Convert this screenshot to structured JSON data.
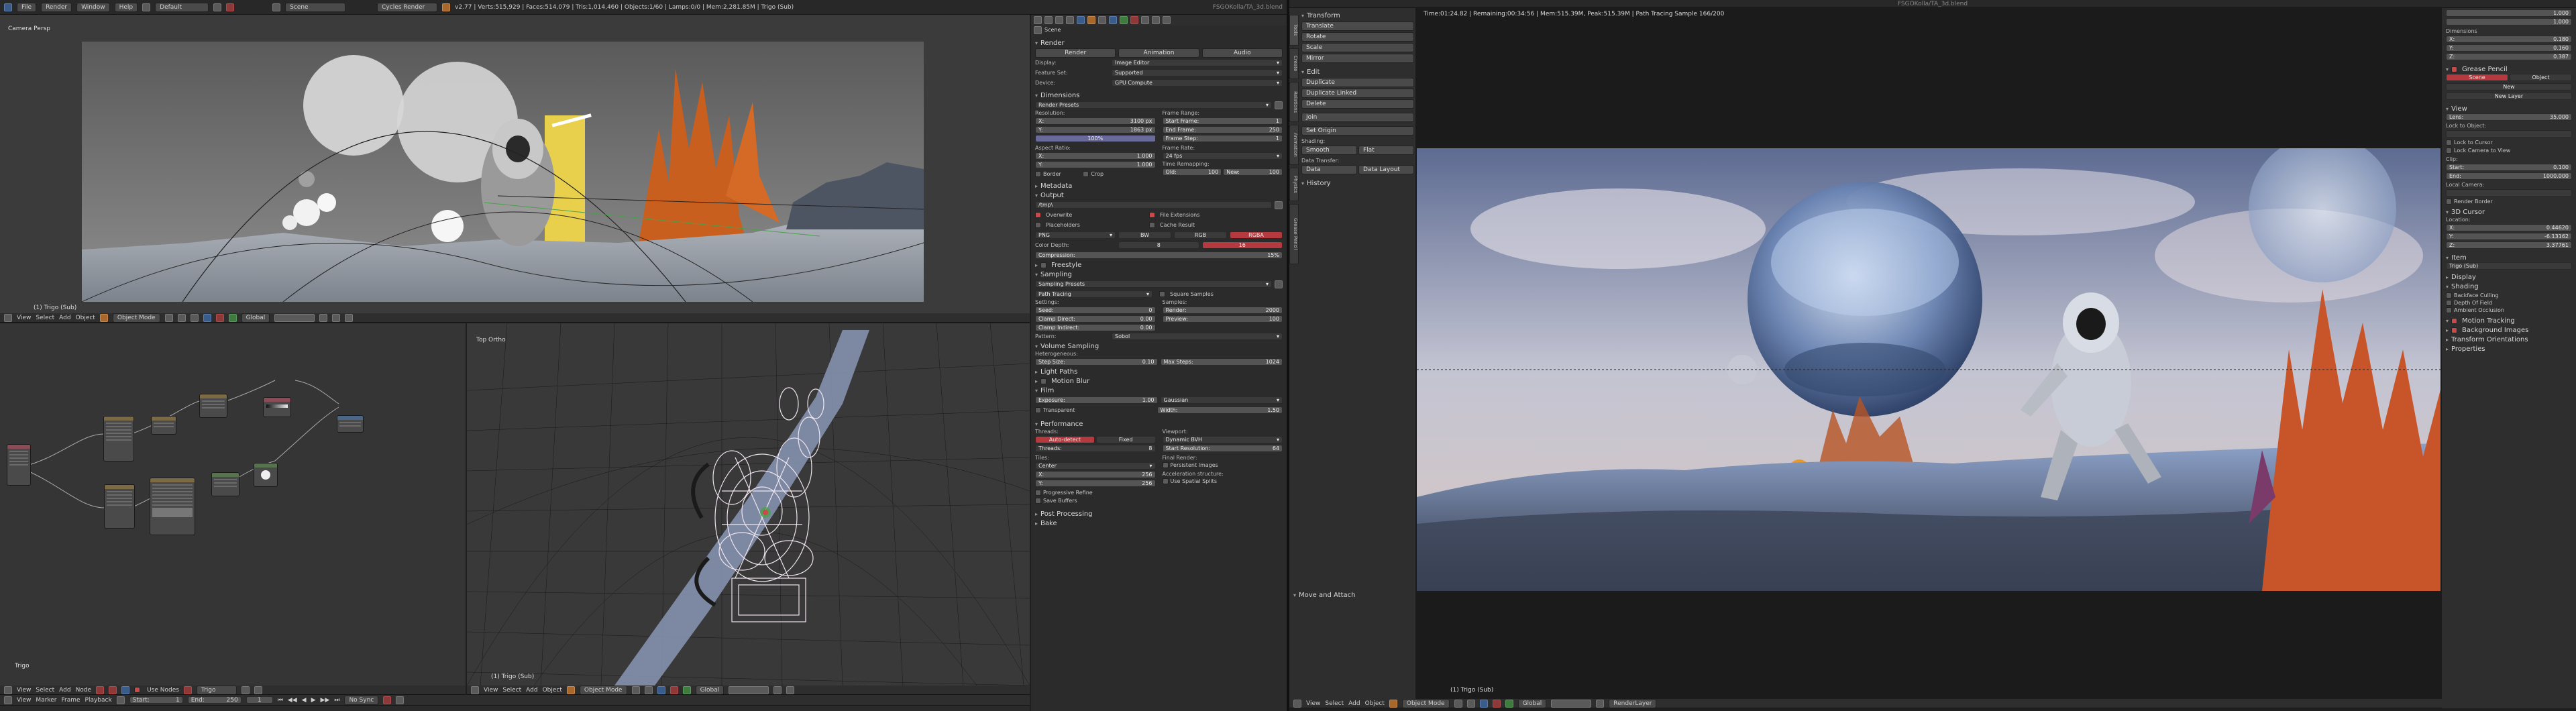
{
  "topbar": {
    "menus": [
      "File",
      "Render",
      "Window",
      "Help"
    ],
    "layout": "Default",
    "scene": "Scene",
    "engine": "Cycles Render",
    "stats": "v2.77 | Verts:515,929 | Faces:514,079 | Tris:1,014,460 | Objects:1/60 | Lamps:0/0 | Mem:2,281.85M | Trigo (Sub)",
    "title_left": "FSGOKolla/TA_3d.blend",
    "title_right": "FSGOKolla/TA_3d.blend"
  },
  "viewport_camera": {
    "label": "Camera Persp",
    "object_label": "(1) Trigo (Sub)",
    "header_items": [
      "View",
      "Select",
      "Add",
      "Object"
    ],
    "mode": "Object Mode",
    "pivot": "Global"
  },
  "node_editor": {
    "label": "Trigo",
    "header_items": [
      "View",
      "Select",
      "Add",
      "Node"
    ],
    "use_nodes": "Use Nodes"
  },
  "viewport_wire": {
    "label": "Top Ortho",
    "object_label": "(1) Trigo (Sub)",
    "header_items": [
      "View",
      "Select",
      "Add",
      "Object"
    ],
    "mode": "Object Mode",
    "pivot": "Global"
  },
  "timeline": {
    "items": [
      "View",
      "Marker",
      "Frame",
      "Playback"
    ],
    "start": "Start:",
    "start_val": "1",
    "end": "End:",
    "end_val": "250",
    "current": "1",
    "sync": "No Sync"
  },
  "properties": {
    "scene_label": "Scene",
    "render_header": "Render",
    "render_buttons": [
      "Render",
      "Animation",
      "Audio"
    ],
    "display_label": "Display:",
    "display_val": "Image Editor",
    "feature_label": "Feature Set:",
    "feature_val": "Supported",
    "device_label": "Device:",
    "device_val": "GPU Compute",
    "dimensions": "Dimensions",
    "render_presets": "Render Presets",
    "resolution": "Resolution:",
    "res_x": "3100 px",
    "res_y": "1863 px",
    "res_pct": "100%",
    "frame_range": "Frame Range:",
    "start_frame": "Start Frame:",
    "start_frame_val": "1",
    "end_frame": "End Frame:",
    "end_frame_val": "250",
    "frame_step": "Frame Step:",
    "frame_step_val": "1",
    "aspect": "Aspect Ratio:",
    "aspect_x": "1.000",
    "aspect_y": "1.000",
    "frame_rate": "Frame Rate:",
    "fps": "24 fps",
    "time_remap": "Time Remapping:",
    "tr_old": "100",
    "tr_new": "100",
    "border": "Border",
    "crop": "Crop",
    "metadata": "Metadata",
    "output": "Output",
    "output_path": "/tmp\\",
    "overwrite": "Overwrite",
    "file_ext": "File Extensions",
    "placeholders": "Placeholders",
    "cache_result": "Cache Result",
    "format": "PNG",
    "bw": "BW",
    "rgb": "RGB",
    "rgba": "RGBA",
    "color_depth": "Color Depth:",
    "depth8": "8",
    "depth16": "16",
    "compression": "Compression:",
    "compression_val": "15%",
    "freestyle": "Freestyle",
    "sampling": "Sampling",
    "sampling_presets": "Sampling Presets",
    "path_tracing": "Path Tracing",
    "square_samples": "Square Samples",
    "settings": "Settings:",
    "seed": "Seed:",
    "seed_val": "0",
    "clamp_direct": "Clamp Direct:",
    "clamp_direct_val": "0.00",
    "clamp_indirect": "Clamp Indirect:",
    "clamp_indirect_val": "0.00",
    "samples": "Samples:",
    "render_samples": "Render:",
    "render_samples_val": "2000",
    "preview_samples": "Preview:",
    "preview_samples_val": "100",
    "pattern": "Pattern:",
    "pattern_val": "Sobol",
    "volume_sampling": "Volume Sampling",
    "heterogeneous": "Heterogeneous:",
    "step_size": "Step Size:",
    "step_size_val": "0.10",
    "max_steps": "Max Steps:",
    "max_steps_val": "1024",
    "light_paths": "Light Paths",
    "motion_blur": "Motion Blur",
    "film": "Film",
    "exposure": "Exposure:",
    "exposure_val": "1.00",
    "filter": "Gaussian",
    "width": "Width:",
    "width_val": "1.50",
    "transparent": "Transparent",
    "performance": "Performance",
    "threads": "Threads:",
    "auto_detect": "Auto-detect",
    "fixed": "Fixed",
    "threads_val": "8",
    "tiles": "Tiles:",
    "center": "Center",
    "tile_x": "256",
    "tile_y": "256",
    "progressive": "Progressive Refine",
    "save_buffers": "Save Buffers",
    "viewport": "Viewport:",
    "dynamic_bvh": "Dynamic BVH",
    "start_res": "Start Resolution:",
    "start_res_val": "64",
    "final_render": "Final Render:",
    "persistent": "Persistent Images",
    "accel": "Acceleration structure:",
    "spatial": "Use Spatial Splits",
    "post_processing": "Post Processing",
    "bake": "Bake"
  },
  "toolshelf": {
    "transform": "Transform",
    "translate": "Translate",
    "rotate": "Rotate",
    "scale": "Scale",
    "mirror": "Mirror",
    "edit": "Edit",
    "duplicate": "Duplicate",
    "dup_linked": "Duplicate Linked",
    "delete": "Delete",
    "join": "Join",
    "set_origin": "Set Origin",
    "shading": "Shading:",
    "smooth": "Smooth",
    "flat": "Flat",
    "data_transfer": "Data Transfer:",
    "data": "Data",
    "data_layout": "Data Layout",
    "history": "History",
    "move_attach": "Move and Attach",
    "tabs": [
      "Tools",
      "Create",
      "Relations",
      "Animation",
      "Physics",
      "Grease Pencil"
    ]
  },
  "render_view": {
    "status": "Time:01:24.82 | Remaining:00:34:56 | Mem:515.39M, Peak:515.39M | Path Tracing Sample 166/200",
    "object_label": "(1) Trigo (Sub)",
    "header_items": [
      "View",
      "Select",
      "Add",
      "Object"
    ],
    "mode": "Object Mode",
    "pivot": "Global",
    "layer": "RenderLayer"
  },
  "npanel": {
    "top_vals": [
      "1.000",
      "1.000"
    ],
    "dimensions": "Dimensions",
    "dim_x": "0.180",
    "dim_y": "0.160",
    "dim_z": "0.387",
    "grease_pencil": "Grease Pencil",
    "scene": "Scene",
    "object": "Object",
    "new": "New",
    "new_layer": "New Layer",
    "view": "View",
    "lens": "Lens:",
    "lens_val": "35.000",
    "lock_object": "Lock to Object:",
    "lock_cursor": "Lock to Cursor",
    "lock_camera": "Lock Camera to View",
    "clip": "Clip:",
    "clip_start": "Start:",
    "clip_start_val": "0.100",
    "clip_end": "End:",
    "clip_end_val": "1000.000",
    "local_camera": "Local Camera:",
    "render_border": "Render Border",
    "cursor3d": "3D Cursor",
    "location": "Location:",
    "loc_x": "0.44620",
    "loc_y": "-6.13162",
    "loc_z": "3.37761",
    "item": "Item",
    "item_name": "Trigo (Sub)",
    "display": "Display",
    "shading": "Shading",
    "backface": "Backface Culling",
    "depth_of_field": "Depth Of Field",
    "ambient": "Ambient Occlusion",
    "motion_tracking": "Motion Tracking",
    "bg_images": "Background Images",
    "transform_orient": "Transform Orientations",
    "properties": "Properties"
  }
}
